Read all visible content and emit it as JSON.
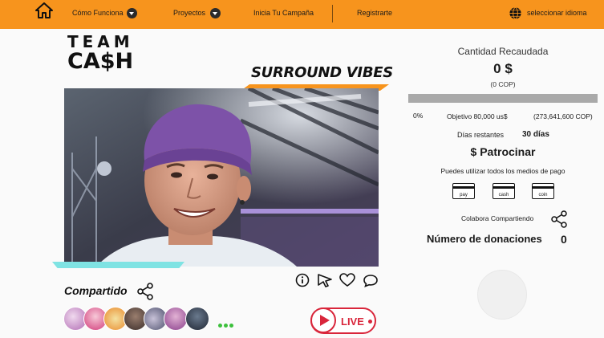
{
  "nav": {
    "items": [
      "Cómo Funciona",
      "Proyectos",
      "Inicia Tu Campaña",
      "Registrarte"
    ],
    "language": "seleccionar idioma",
    "bg_color": "#f7941d"
  },
  "logo": {
    "line1": "TEAM",
    "line2": "CA$H"
  },
  "campaign": {
    "title": "SURROUND VIBES"
  },
  "shared": {
    "label": "Compartido",
    "live_label": "LIVE"
  },
  "stats": {
    "raised_label": "Cantidad Recaudada",
    "raised_value": "0 $",
    "raised_cop": "(0 COP)",
    "percent": "0%",
    "progress": 0,
    "goal": "Objetivo 80,000 us$",
    "goal_cop": "(273,641,600 COP)",
    "days_label": "Días restantes",
    "days_value": "30 días",
    "sponsor": "$ Patrocinar",
    "payment_text": "Puedes utilizar todos los medios de pago",
    "payment_methods": [
      "pay",
      "cash",
      "coin"
    ],
    "share_text": "Colabora Compartiendo",
    "donations_label": "Número de donaciones",
    "donations_value": "0"
  },
  "icons": [
    "home-icon",
    "globe-icon",
    "share-icon",
    "info-icon",
    "cursor-icon",
    "heart-icon",
    "comment-icon",
    "play-icon"
  ],
  "colors": {
    "accent": "#f7941d",
    "live": "#d9263b",
    "cyan": "#7fe3e3"
  }
}
